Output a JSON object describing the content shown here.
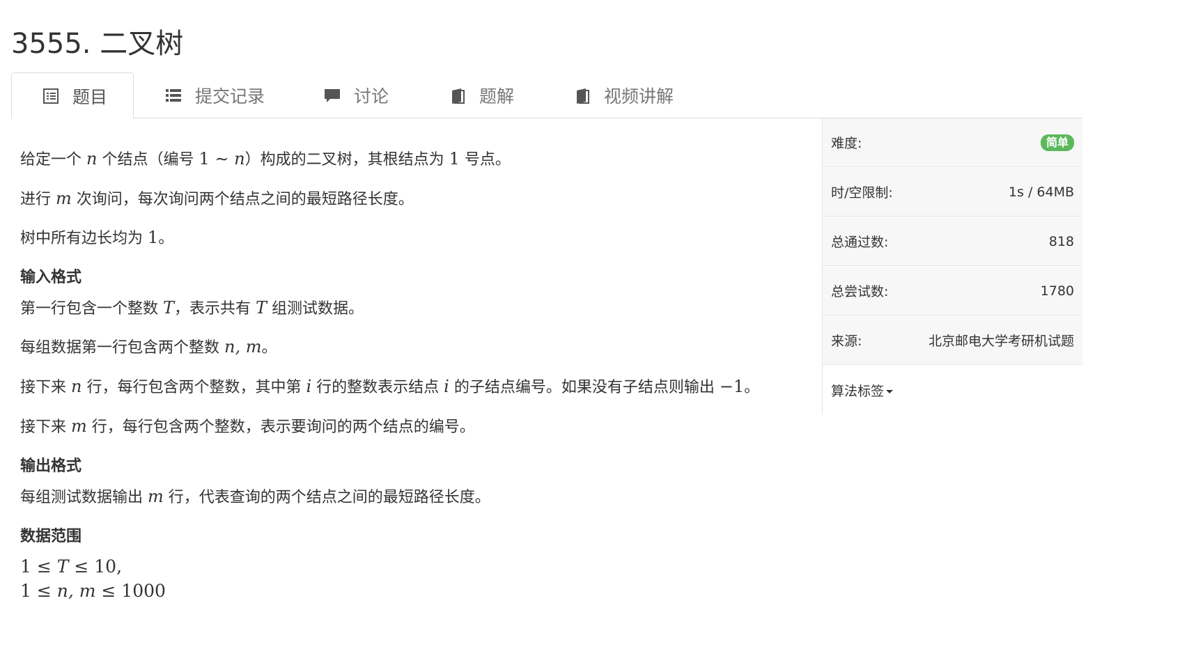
{
  "problem": {
    "title": "3555. 二叉树"
  },
  "tabs": [
    {
      "label": "题目",
      "icon": "document-list-icon"
    },
    {
      "label": "提交记录",
      "icon": "list-icon"
    },
    {
      "label": "讨论",
      "icon": "comment-icon"
    },
    {
      "label": "题解",
      "icon": "book-icon"
    },
    {
      "label": "视频讲解",
      "icon": "book-icon"
    }
  ],
  "statement": {
    "p1": {
      "a": "给定一个 ",
      "n": "n",
      "b": " 个结点（编号 ",
      "one": "1",
      "tilde": " ∼ ",
      "n2": "n",
      "c": "）构成的二叉树，其根结点为 ",
      "one2": "1",
      "d": " 号点。"
    },
    "p2": {
      "a": "进行 ",
      "m": "m",
      "b": " 次询问，每次询问两个结点之间的最短路径长度。"
    },
    "p3": {
      "a": "树中所有边长均为 ",
      "one": "1",
      "b": "。"
    },
    "input_heading": "输入格式",
    "i1": {
      "a": "第一行包含一个整数 ",
      "T": "T",
      "b": "，表示共有 ",
      "T2": "T",
      "c": " 组测试数据。"
    },
    "i2": {
      "a": "每组数据第一行包含两个整数 ",
      "nm": "n, m",
      "b": "。"
    },
    "i3": {
      "a": "接下来 ",
      "n": "n",
      "b": " 行，每行包含两个整数，其中第 ",
      "i": "i",
      "c": " 行的整数表示结点 ",
      "i2": "i",
      "d": " 的子结点编号。如果没有子结点则输出 ",
      "neg": "−1",
      "e": "。"
    },
    "i4": {
      "a": "接下来 ",
      "m": "m",
      "b": " 行，每行包含两个整数，表示要询问的两个结点的编号。"
    },
    "output_heading": "输出格式",
    "o1": {
      "a": "每组测试数据输出 ",
      "m": "m",
      "b": " 行，代表查询的两个结点之间的最短路径长度。"
    },
    "range_heading": "数据范围",
    "r1": {
      "a": "1 ≤ ",
      "T": "T",
      "b": " ≤ 10,"
    },
    "r2": {
      "a": "1 ≤ ",
      "nm": "n, m",
      "b": " ≤ 1000"
    }
  },
  "sidebar": {
    "difficulty_label": "难度:",
    "difficulty_value": "简单",
    "limit_label": "时/空限制:",
    "limit_value": "1s / 64MB",
    "passed_label": "总通过数:",
    "passed_value": "818",
    "tried_label": "总尝试数:",
    "tried_value": "1780",
    "source_label": "来源:",
    "source_value": "北京邮电大学考研机试题",
    "tags_label": "算法标签"
  },
  "colors": {
    "badge_green": "#5cb85c",
    "border": "#dddddd",
    "sidebar_bg": "#f7f7f7"
  }
}
